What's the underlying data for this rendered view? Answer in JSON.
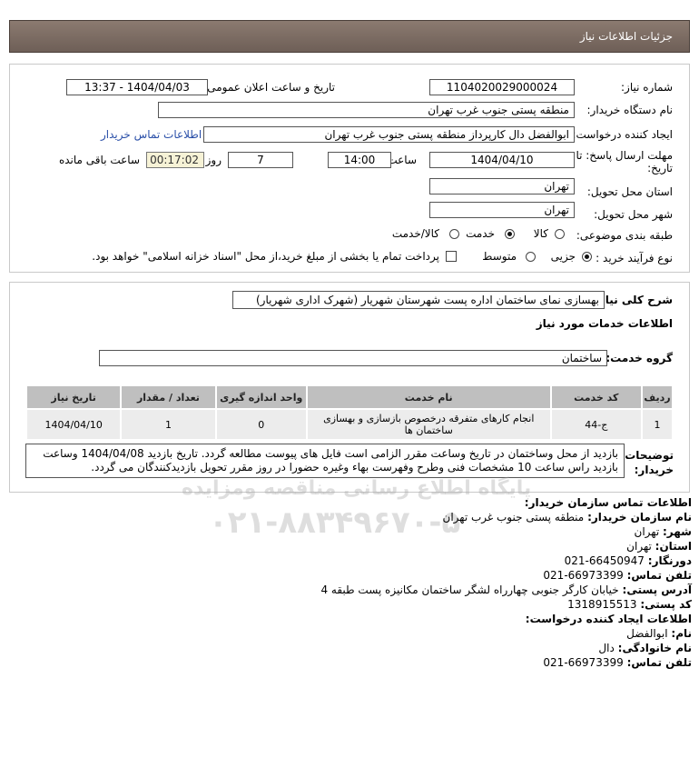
{
  "header": {
    "title": "جزئیات اطلاعات نیاز"
  },
  "form": {
    "need_number_label": "شماره نیاز:",
    "need_number": "1104020029000024",
    "announce_label": "تاریخ و ساعت اعلان عمومی:",
    "announce_value": "1404/04/03 - 13:37",
    "buyer_org_label": "نام دستگاه خریدار:",
    "buyer_org": "منطقه پستی جنوب غرب تهران",
    "creator_label": "ایجاد کننده درخواست:",
    "creator": "ابوالفضل  دال  کارپرداز منطقه پستی جنوب غرب تهران",
    "contact_link": "اطلاعات تماس خریدار",
    "deadline_label_1": "مهلت ارسال پاسخ: تا",
    "deadline_label_2": "تاریخ:",
    "deadline_date": "1404/04/10",
    "time_label": "ساعت",
    "deadline_time": "14:00",
    "days": "7",
    "days_label": "روز و",
    "remaining": "00:17:02",
    "remaining_label": "ساعت باقی مانده",
    "province_label": "استان محل تحویل:",
    "province": "تهران",
    "city_label": "شهر محل تحویل:",
    "city": "تهران",
    "category_label": "طبقه بندی موضوعی:",
    "category_options": [
      "کالا",
      "خدمت",
      "کالا/خدمت"
    ],
    "purchase_type_label": "نوع فرآیند خرید :",
    "purchase_options": [
      "جزیی",
      "متوسط"
    ],
    "treasury_note": "پرداخت تمام یا بخشی از مبلغ خرید،از محل \"اسناد خزانه اسلامی\" خواهد بود."
  },
  "summary": {
    "label": "شرح کلی نیاز:",
    "value": "بهسازی نمای ساختمان اداره پست شهرستان شهریار (شهرک اداری شهریار)",
    "services_title": "اطلاعات خدمات مورد نیاز",
    "group_label": "گروه خدمت:",
    "group_value": "ساختمان"
  },
  "table": {
    "headers": [
      "ردیف",
      "کد خدمت",
      "نام خدمت",
      "واحد اندازه گیری",
      "تعداد / مقدار",
      "تاریخ نیاز"
    ],
    "rows": [
      [
        "1",
        "ج-44",
        "انجام کارهای متفرقه درخصوص بازسازی و بهسازی ساختمان ها",
        "0",
        "1",
        "1404/04/10"
      ]
    ]
  },
  "notes": {
    "label_1": "توضیحات",
    "label_2": "خریدار:",
    "text": "بازدید از محل وساختمان در تاریخ وساعت مقرر الزامی است فایل های پیوست مطالعه گردد. تاریخ بازدید 1404/04/08 وساعت بازدید راس ساعت 10 مشخصات فنی وطرح وفهرست بهاء وغیره حضورا در روز مقرر تحویل بازدیدکنندگان می گردد."
  },
  "contact": {
    "title": "اطلاعات تماس سازمان خریدار:",
    "org_label": "نام سازمان خریدار:",
    "org": "منطقه پستی جنوب غرب تهران",
    "city_label": "شهر:",
    "city": "تهران",
    "province_label": "استان:",
    "province": "تهران",
    "fax_label": "دورنگار:",
    "fax": "66450947-021",
    "phone_label": "تلفن تماس:",
    "phone": "66973399-021",
    "address_label": "آدرس پستی:",
    "address": "خیابان کارگر جنوبی چهارراه لشگر ساختمان مکانیزه پست طبقه 4",
    "postal_label": "کد پستی:",
    "postal": "1318915513",
    "creator_title": "اطلاعات ایجاد کننده درخواست:",
    "first_name_label": "نام:",
    "first_name": "ابوالفضل",
    "last_name_label": "نام خانوادگی:",
    "last_name": "دال",
    "creator_phone_label": "تلفن تماس:",
    "creator_phone": "66973399-021"
  },
  "watermark": {
    "line1": "پایگاه اطلاع رسانی مناقصه ومزایده",
    "line2": "۰۲۱-۸۸۳۴۹۶۷۰-۵"
  }
}
